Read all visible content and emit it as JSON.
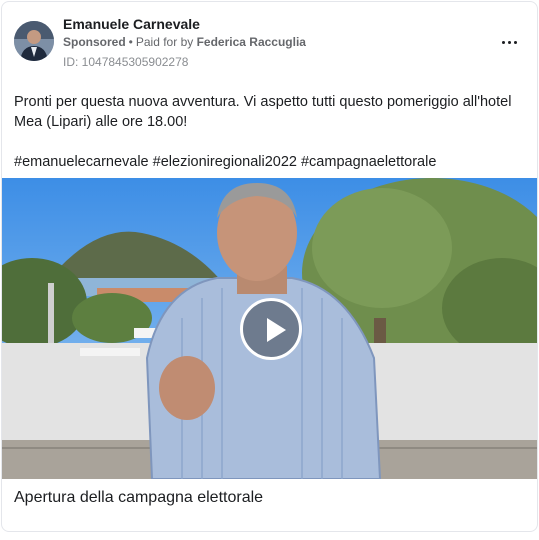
{
  "post": {
    "page_name": "Emanuele Carnevale",
    "sponsored_label": "Sponsored",
    "separator": "•",
    "paid_for_prefix": "Paid for by",
    "payer": "Federica Raccuglia",
    "ad_id": "ID: 1047845305902278",
    "more_icon": "more-horizontal-icon",
    "body": "Pronti per questa nuova avventura. Vi aspetto tutti questo pomeriggio all'hotel Mea (Lipari) alle ore 18.00!",
    "hashtags": "#emanuelecarnevale #elezioniregionali2022 #campagnaelettorale",
    "video_play_icon": "play-icon",
    "caption": "Apertura della campagna elettorale"
  }
}
